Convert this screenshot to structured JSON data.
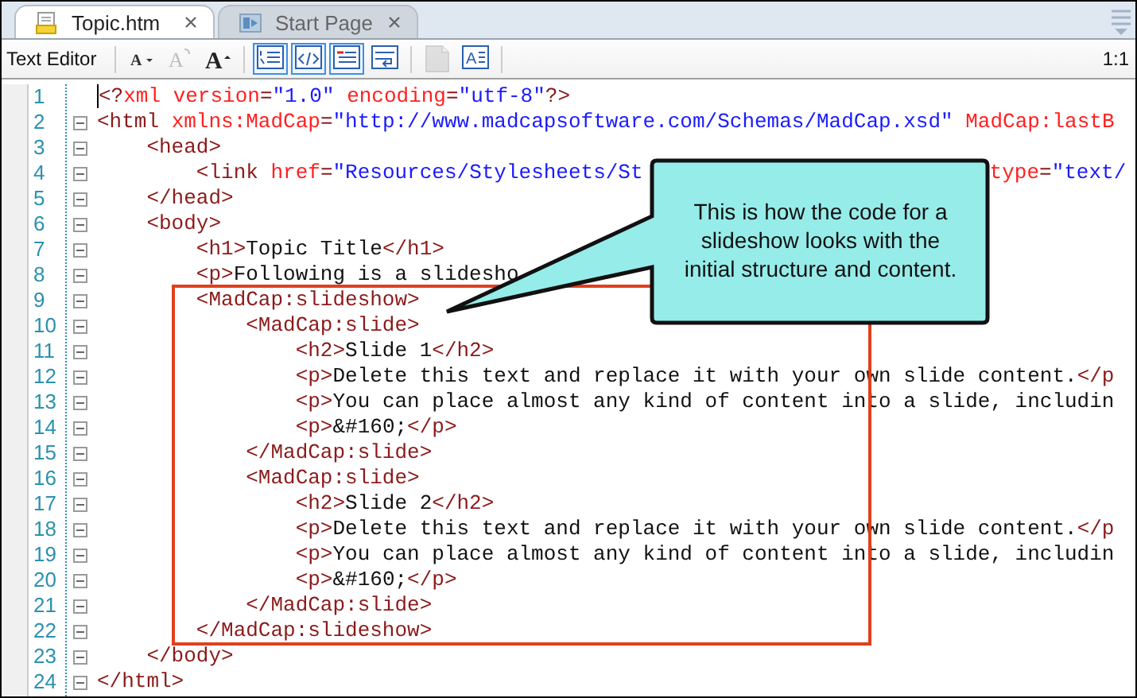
{
  "tabs": [
    {
      "label": "Topic.htm",
      "selected": true,
      "kind": "document"
    },
    {
      "label": "Start Page",
      "selected": false,
      "kind": "start"
    }
  ],
  "toolbar": {
    "label": "Text Editor",
    "position": "1:1",
    "tools": [
      {
        "kind": "font-smaller",
        "glyph": "A",
        "on": false,
        "disabled": false
      },
      {
        "kind": "font-reset",
        "glyph": "A",
        "on": false,
        "disabled": true
      },
      {
        "kind": "font-larger",
        "glyph": "A",
        "on": false,
        "disabled": false
      },
      {
        "kind": "line-numbers",
        "on": true,
        "disabled": false
      },
      {
        "kind": "code",
        "on": true,
        "disabled": false
      },
      {
        "kind": "tags",
        "on": true,
        "disabled": false
      },
      {
        "kind": "wrap",
        "on": false,
        "disabled": false
      },
      {
        "kind": "document",
        "on": false,
        "disabled": true
      },
      {
        "kind": "text-format",
        "glyph": "A",
        "on": false,
        "disabled": false
      }
    ]
  },
  "editor": {
    "lines": [
      {
        "number": "1",
        "fold": false,
        "segments": [
          {
            "kind": "tag",
            "text": "<?"
          },
          {
            "kind": "attr",
            "text": "xml version"
          },
          {
            "kind": "tag",
            "text": "="
          },
          {
            "kind": "value",
            "text": "\"1.0\""
          },
          {
            "kind": "attr",
            "text": " encoding"
          },
          {
            "kind": "tag",
            "text": "="
          },
          {
            "kind": "value",
            "text": "\"utf-8\""
          },
          {
            "kind": "tag",
            "text": "?>"
          }
        ]
      },
      {
        "number": "2",
        "fold": true,
        "segments": [
          {
            "kind": "tag",
            "text": "<html "
          },
          {
            "kind": "attr",
            "text": "xmlns:MadCap"
          },
          {
            "kind": "tag",
            "text": "="
          },
          {
            "kind": "value",
            "text": "\"http://www.madcapsoftware.com/Schemas/MadCap.xsd\""
          },
          {
            "kind": "attr",
            "text": " MadCap:lastB"
          }
        ]
      },
      {
        "number": "3",
        "fold": true,
        "segments": [
          {
            "kind": "tag",
            "text": "    <head>"
          }
        ]
      },
      {
        "number": "4",
        "fold": true,
        "segments": [
          {
            "kind": "tag",
            "text": "        <link "
          },
          {
            "kind": "attr",
            "text": "href"
          },
          {
            "kind": "tag",
            "text": "="
          },
          {
            "kind": "value",
            "text": "\"Resources/Stylesheets/St"
          },
          {
            "kind": "attr",
            "text": "type",
            "gap": true
          },
          {
            "kind": "tag",
            "text": "="
          },
          {
            "kind": "value",
            "text": "\"text/"
          }
        ]
      },
      {
        "number": "5",
        "fold": true,
        "segments": [
          {
            "kind": "tag",
            "text": "    </head>"
          }
        ]
      },
      {
        "number": "6",
        "fold": true,
        "segments": [
          {
            "kind": "tag",
            "text": "    <body>"
          }
        ]
      },
      {
        "number": "7",
        "fold": true,
        "segments": [
          {
            "kind": "tag",
            "text": "        <h1>"
          },
          {
            "kind": "text",
            "text": "Topic Title"
          },
          {
            "kind": "tag",
            "text": "</h1>"
          }
        ]
      },
      {
        "number": "8",
        "fold": true,
        "segments": [
          {
            "kind": "tag",
            "text": "        <p>"
          },
          {
            "kind": "text",
            "text": "Following is a slidesho"
          }
        ]
      },
      {
        "number": "9",
        "fold": true,
        "segments": [
          {
            "kind": "tag",
            "text": "        <MadCap:slideshow>"
          }
        ]
      },
      {
        "number": "10",
        "fold": true,
        "segments": [
          {
            "kind": "tag",
            "text": "            <MadCap:slide>"
          }
        ]
      },
      {
        "number": "11",
        "fold": true,
        "segments": [
          {
            "kind": "tag",
            "text": "                <h2>"
          },
          {
            "kind": "text",
            "text": "Slide 1"
          },
          {
            "kind": "tag",
            "text": "</h2>"
          }
        ]
      },
      {
        "number": "12",
        "fold": true,
        "segments": [
          {
            "kind": "tag",
            "text": "                <p>"
          },
          {
            "kind": "text",
            "text": "Delete this text and replace it with your own slide content."
          },
          {
            "kind": "tag",
            "text": "</p"
          }
        ]
      },
      {
        "number": "13",
        "fold": true,
        "segments": [
          {
            "kind": "tag",
            "text": "                <p>"
          },
          {
            "kind": "text",
            "text": "You can place almost any kind of content into a slide, includin"
          }
        ]
      },
      {
        "number": "14",
        "fold": true,
        "segments": [
          {
            "kind": "tag",
            "text": "                <p>"
          },
          {
            "kind": "text",
            "text": "&#160;"
          },
          {
            "kind": "tag",
            "text": "</p>"
          }
        ]
      },
      {
        "number": "15",
        "fold": true,
        "segments": [
          {
            "kind": "tag",
            "text": "            </MadCap:slide>"
          }
        ]
      },
      {
        "number": "16",
        "fold": true,
        "segments": [
          {
            "kind": "tag",
            "text": "            <MadCap:slide>"
          }
        ]
      },
      {
        "number": "17",
        "fold": true,
        "segments": [
          {
            "kind": "tag",
            "text": "                <h2>"
          },
          {
            "kind": "text",
            "text": "Slide 2"
          },
          {
            "kind": "tag",
            "text": "</h2>"
          }
        ]
      },
      {
        "number": "18",
        "fold": true,
        "segments": [
          {
            "kind": "tag",
            "text": "                <p>"
          },
          {
            "kind": "text",
            "text": "Delete this text and replace it with your own slide content."
          },
          {
            "kind": "tag",
            "text": "</p"
          }
        ]
      },
      {
        "number": "19",
        "fold": true,
        "segments": [
          {
            "kind": "tag",
            "text": "                <p>"
          },
          {
            "kind": "text",
            "text": "You can place almost any kind of content into a slide, includin"
          }
        ]
      },
      {
        "number": "20",
        "fold": true,
        "segments": [
          {
            "kind": "tag",
            "text": "                <p>"
          },
          {
            "kind": "text",
            "text": "&#160;"
          },
          {
            "kind": "tag",
            "text": "</p>"
          }
        ]
      },
      {
        "number": "21",
        "fold": true,
        "segments": [
          {
            "kind": "tag",
            "text": "            </MadCap:slide>"
          }
        ]
      },
      {
        "number": "22",
        "fold": true,
        "segments": [
          {
            "kind": "tag",
            "text": "        </MadCap:slideshow>"
          }
        ]
      },
      {
        "number": "23",
        "fold": true,
        "segments": [
          {
            "kind": "tag",
            "text": "    </body>"
          }
        ]
      },
      {
        "number": "24",
        "fold": true,
        "segments": [
          {
            "kind": "tag",
            "text": "</html>"
          }
        ]
      }
    ]
  },
  "callout": {
    "text": "This is how the code for a slideshow looks with the initial structure and content."
  }
}
